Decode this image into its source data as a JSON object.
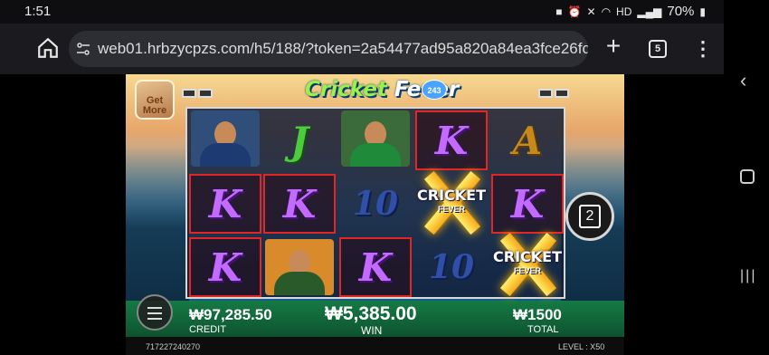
{
  "status_bar": {
    "time": "1:51",
    "hd": "HD",
    "battery": "70%"
  },
  "browser": {
    "url": "web01.hrbzycpzs.com/h5/188/?token=2a54477ad95a820a84ea3fce26fc",
    "tab_count": "5"
  },
  "game": {
    "title_part1": "Cricket",
    "title_part2": "Fever",
    "ways": "243",
    "get_more": "Get More",
    "reels": [
      [
        "player",
        "K",
        "K"
      ],
      [
        "J",
        "K",
        "bowler"
      ],
      [
        "batsman",
        "10",
        "K"
      ],
      [
        "K",
        "scatter",
        "10"
      ],
      [
        "A",
        "K",
        "scatter"
      ]
    ],
    "scatter_label_top": "CRICKET",
    "scatter_label_bottom": "FEVER",
    "free_spin_badge": "2",
    "credit_value": "₩97,285.50",
    "credit_label": "CREDIT",
    "win_value": "₩5,385.00",
    "win_label": "WIN",
    "total_value": "₩1500",
    "total_label": "TOTAL",
    "session_id": "717227240270",
    "level_label": "LEVEL : X50"
  },
  "colors": {
    "win_border": "#e12626",
    "k_symbol": "#c46bff",
    "j_symbol": "#4ccb3d"
  }
}
